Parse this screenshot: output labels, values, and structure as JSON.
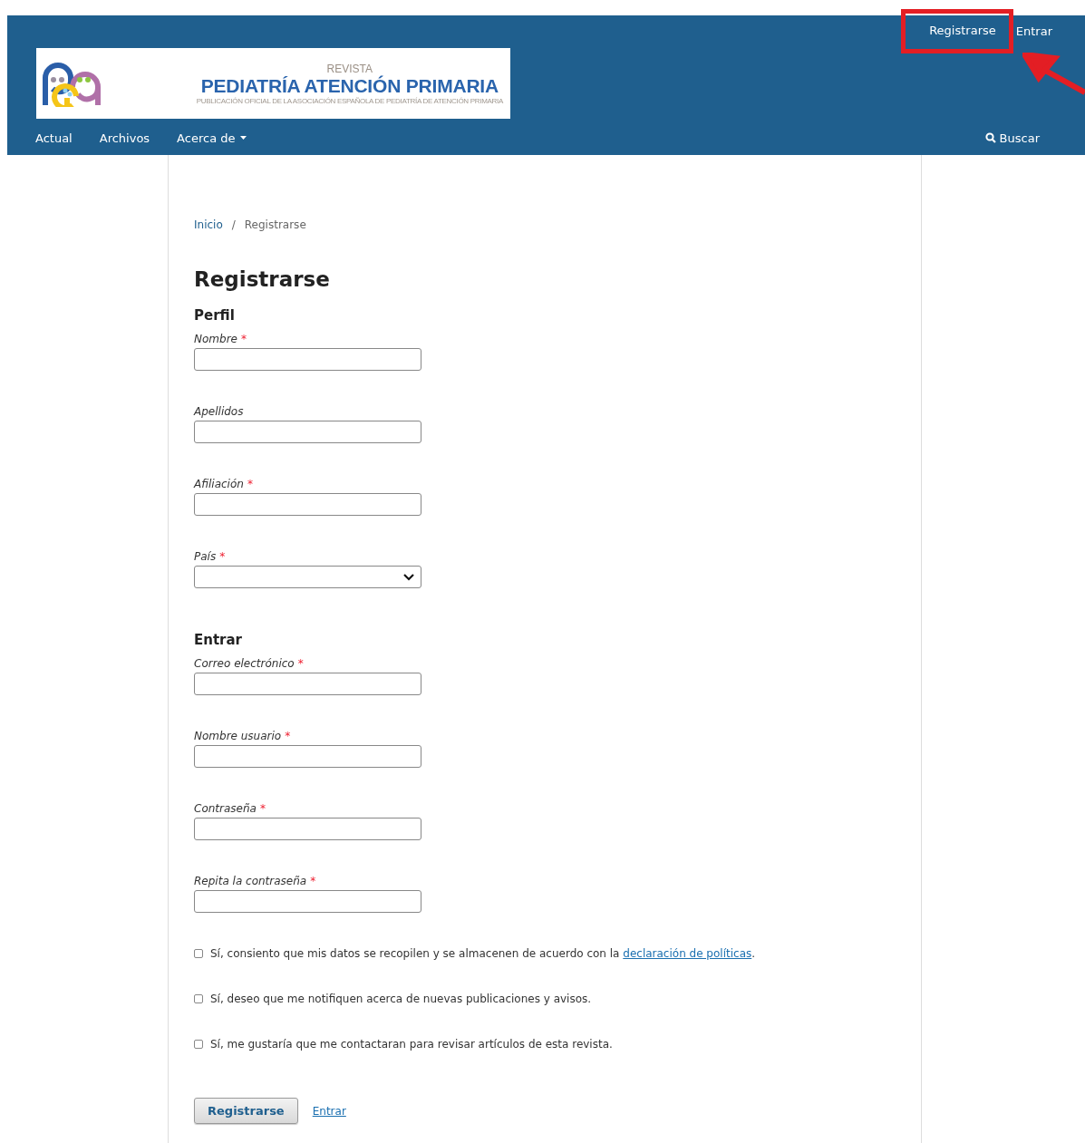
{
  "header": {
    "user_links": [
      {
        "label": "Registrarse",
        "highlighted": true
      },
      {
        "label": "Entrar",
        "highlighted": false
      }
    ],
    "logo": {
      "kicker": "REVISTA",
      "title": "PEDIATRÍA ATENCIÓN PRIMARIA",
      "subtitle": "PUBLICACIÓN OFICIAL DE LA ASOCIACIÓN ESPAÑOLA DE PEDIATRÍA DE ATENCIÓN PRIMARIA"
    },
    "nav": [
      {
        "label": "Actual",
        "dropdown": false
      },
      {
        "label": "Archivos",
        "dropdown": false
      },
      {
        "label": "Acerca de",
        "dropdown": true
      }
    ],
    "search": "Buscar"
  },
  "breadcrumb": {
    "home": "Inicio",
    "separator": "/",
    "current": "Registrarse"
  },
  "title": "Registrarse",
  "sections": [
    {
      "heading": "Perfil",
      "fields": [
        {
          "label": "Nombre",
          "required": true,
          "kind": "text"
        },
        {
          "label": "Apellidos",
          "required": false,
          "kind": "text"
        },
        {
          "label": "Afiliación",
          "required": true,
          "kind": "text"
        },
        {
          "label": "País",
          "required": true,
          "kind": "select"
        }
      ]
    },
    {
      "heading": "Entrar",
      "fields": [
        {
          "label": "Correo electrónico",
          "required": true,
          "kind": "text"
        },
        {
          "label": "Nombre usuario",
          "required": true,
          "kind": "text"
        },
        {
          "label": "Contraseña",
          "required": true,
          "kind": "password"
        },
        {
          "label": "Repita la contraseña",
          "required": true,
          "kind": "password"
        }
      ]
    }
  ],
  "required_mark": "*",
  "consents": [
    {
      "text": "Sí, consiento que mis datos se recopilen y se almacenen de acuerdo con la ",
      "link": "declaración de políticas",
      "after": ".",
      "checked": false
    },
    {
      "text": "Sí, deseo que me notifiquen acerca de nuevas publicaciones y avisos.",
      "checked": false
    },
    {
      "text": "Sí, me gustaría que me contactaran para revisar artículos de esta revista.",
      "checked": false
    }
  ],
  "actions": {
    "submit": "Registrarse",
    "login_link": "Entrar"
  }
}
